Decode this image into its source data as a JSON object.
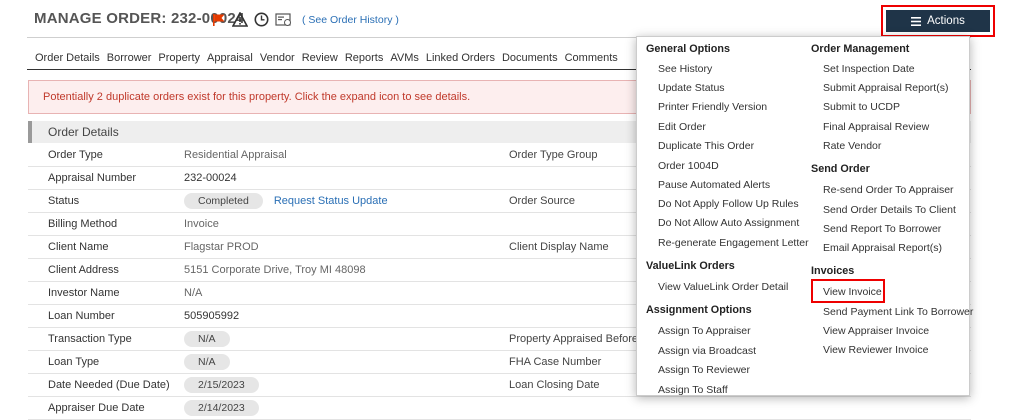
{
  "header": {
    "title": "MANAGE ORDER: 232-00024",
    "history_link": "( See Order History )",
    "actions_label": "Actions"
  },
  "tabs": [
    "Order Details",
    "Borrower",
    "Property",
    "Appraisal",
    "Vendor",
    "Review",
    "Reports",
    "AVMs",
    "Linked Orders",
    "Documents",
    "Comments"
  ],
  "alert": "Potentially 2 duplicate orders exist for this property. Click the expand icon to see details.",
  "section_title": "Order Details",
  "rows": [
    {
      "label": "Order Type",
      "value": "Residential Appraisal",
      "label2": "Order Type Group"
    },
    {
      "label": "Appraisal Number",
      "value": "232-00024",
      "label2": ""
    },
    {
      "label": "Status",
      "value": "Completed",
      "link": "Request Status Update",
      "label2": "Order Source"
    },
    {
      "label": "Billing Method",
      "value": "Invoice",
      "label2": ""
    },
    {
      "label": "Client Name",
      "value": "Flagstar PROD",
      "label2": "Client Display Name"
    },
    {
      "label": "Client Address",
      "value": "5151 Corporate Drive, Troy MI 48098",
      "label2": ""
    },
    {
      "label": "Investor Name",
      "value": "N/A",
      "label2": ""
    },
    {
      "label": "Loan Number",
      "value": "505905992",
      "label2": ""
    },
    {
      "label": "Transaction Type",
      "value": "N/A",
      "label2": "Property Appraised Before"
    },
    {
      "label": "Loan Type",
      "value": "N/A",
      "label2": "FHA Case Number"
    },
    {
      "label": "Date Needed (Due Date)",
      "value": "2/15/2023",
      "label2": "Loan Closing Date"
    },
    {
      "label": "Appraiser Due Date",
      "value": "2/14/2023",
      "label2": ""
    }
  ],
  "menu": {
    "left": [
      {
        "type": "h",
        "text": "General Options"
      },
      {
        "type": "i",
        "text": "See History"
      },
      {
        "type": "i",
        "text": "Update Status"
      },
      {
        "type": "i",
        "text": "Printer Friendly Version"
      },
      {
        "type": "i",
        "text": "Edit Order"
      },
      {
        "type": "i",
        "text": "Duplicate This Order"
      },
      {
        "type": "i",
        "text": "Order 1004D"
      },
      {
        "type": "i",
        "text": "Pause Automated Alerts"
      },
      {
        "type": "i",
        "text": "Do Not Apply Follow Up Rules"
      },
      {
        "type": "i",
        "text": "Do Not Allow Auto Assignment"
      },
      {
        "type": "i",
        "text": "Re-generate Engagement Letter"
      },
      {
        "type": "h",
        "text": "ValueLink Orders"
      },
      {
        "type": "i",
        "text": "View ValueLink Order Detail"
      },
      {
        "type": "h",
        "text": "Assignment Options"
      },
      {
        "type": "i",
        "text": "Assign To Appraiser"
      },
      {
        "type": "i",
        "text": "Assign via Broadcast"
      },
      {
        "type": "i",
        "text": "Assign To Reviewer"
      },
      {
        "type": "i",
        "text": "Assign To Staff"
      }
    ],
    "right": [
      {
        "type": "h",
        "text": "Order Management"
      },
      {
        "type": "i",
        "text": "Set Inspection Date"
      },
      {
        "type": "i",
        "text": "Submit Appraisal Report(s)"
      },
      {
        "type": "i",
        "text": "Submit to UCDP"
      },
      {
        "type": "i",
        "text": "Final Appraisal Review"
      },
      {
        "type": "i",
        "text": "Rate Vendor"
      },
      {
        "type": "h",
        "text": "Send Order"
      },
      {
        "type": "i",
        "text": "Re-send Order To Appraiser"
      },
      {
        "type": "i",
        "text": "Send Order Details To Client"
      },
      {
        "type": "i",
        "text": "Send Report To Borrower"
      },
      {
        "type": "i",
        "text": "Email Appraisal Report(s)"
      },
      {
        "type": "h",
        "text": "Invoices"
      },
      {
        "type": "i",
        "text": "View Invoice"
      },
      {
        "type": "i",
        "text": "Send Payment Link To Borrower"
      },
      {
        "type": "i",
        "text": "View Appraiser Invoice"
      },
      {
        "type": "i",
        "text": "View Reviewer Invoice"
      }
    ]
  }
}
